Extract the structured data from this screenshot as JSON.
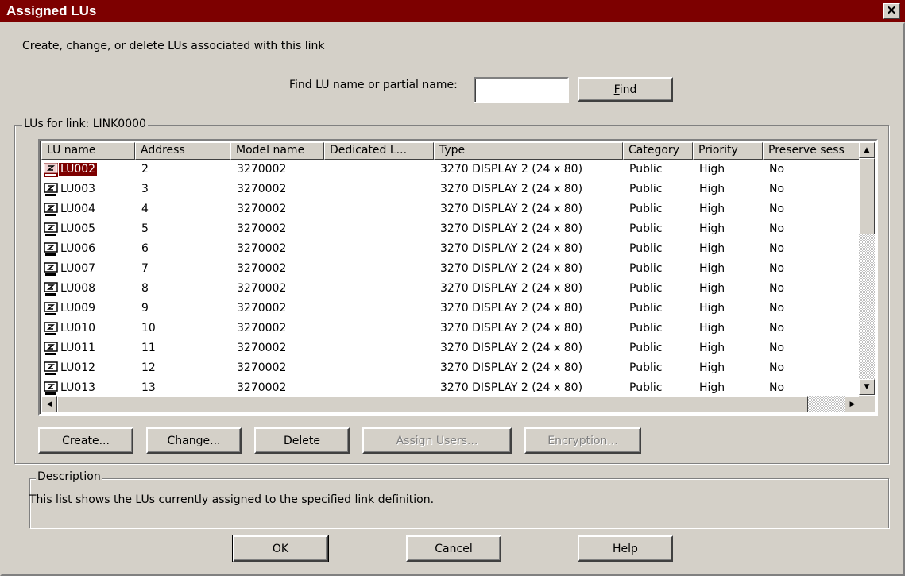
{
  "window": {
    "title": "Assigned LUs",
    "close_label": "✕"
  },
  "intro_text": "Create, change, or delete LUs associated with this link",
  "find": {
    "label": "Find LU name or partial name:",
    "value": "",
    "button_label": "Find",
    "button_accel": "F"
  },
  "lus_group": {
    "label": "LUs for link:  LINK0000"
  },
  "table": {
    "columns": [
      "LU name",
      "Address",
      "Model name",
      "Dedicated L...",
      "Type",
      "Category",
      "Priority",
      "Preserve sess"
    ],
    "rows": [
      {
        "lu": "LU002",
        "address": "2",
        "model": "3270002",
        "dedicated": "",
        "type": "3270 DISPLAY 2 (24 x 80)",
        "category": "Public",
        "priority": "High",
        "preserve": "No"
      },
      {
        "lu": "LU003",
        "address": "3",
        "model": "3270002",
        "dedicated": "",
        "type": "3270 DISPLAY 2 (24 x 80)",
        "category": "Public",
        "priority": "High",
        "preserve": "No"
      },
      {
        "lu": "LU004",
        "address": "4",
        "model": "3270002",
        "dedicated": "",
        "type": "3270 DISPLAY 2 (24 x 80)",
        "category": "Public",
        "priority": "High",
        "preserve": "No"
      },
      {
        "lu": "LU005",
        "address": "5",
        "model": "3270002",
        "dedicated": "",
        "type": "3270 DISPLAY 2 (24 x 80)",
        "category": "Public",
        "priority": "High",
        "preserve": "No"
      },
      {
        "lu": "LU006",
        "address": "6",
        "model": "3270002",
        "dedicated": "",
        "type": "3270 DISPLAY 2 (24 x 80)",
        "category": "Public",
        "priority": "High",
        "preserve": "No"
      },
      {
        "lu": "LU007",
        "address": "7",
        "model": "3270002",
        "dedicated": "",
        "type": "3270 DISPLAY 2 (24 x 80)",
        "category": "Public",
        "priority": "High",
        "preserve": "No"
      },
      {
        "lu": "LU008",
        "address": "8",
        "model": "3270002",
        "dedicated": "",
        "type": "3270 DISPLAY 2 (24 x 80)",
        "category": "Public",
        "priority": "High",
        "preserve": "No"
      },
      {
        "lu": "LU009",
        "address": "9",
        "model": "3270002",
        "dedicated": "",
        "type": "3270 DISPLAY 2 (24 x 80)",
        "category": "Public",
        "priority": "High",
        "preserve": "No"
      },
      {
        "lu": "LU010",
        "address": "10",
        "model": "3270002",
        "dedicated": "",
        "type": "3270 DISPLAY 2 (24 x 80)",
        "category": "Public",
        "priority": "High",
        "preserve": "No"
      },
      {
        "lu": "LU011",
        "address": "11",
        "model": "3270002",
        "dedicated": "",
        "type": "3270 DISPLAY 2 (24 x 80)",
        "category": "Public",
        "priority": "High",
        "preserve": "No"
      },
      {
        "lu": "LU012",
        "address": "12",
        "model": "3270002",
        "dedicated": "",
        "type": "3270 DISPLAY 2 (24 x 80)",
        "category": "Public",
        "priority": "High",
        "preserve": "No"
      },
      {
        "lu": "LU013",
        "address": "13",
        "model": "3270002",
        "dedicated": "",
        "type": "3270 DISPLAY 2 (24 x 80)",
        "category": "Public",
        "priority": "High",
        "preserve": "No"
      }
    ],
    "selected_row": 0,
    "row_icon": "display-terminal-icon"
  },
  "actions": {
    "create": "Create...",
    "change": "Change...",
    "delete": "Delete",
    "assign_users": "Assign Users...",
    "encryption": "Encryption..."
  },
  "description": {
    "label": "Description",
    "text": "This list shows the LUs currently assigned to the specified link definition."
  },
  "footer": {
    "ok": "OK",
    "cancel": "Cancel",
    "help": "Help"
  },
  "colors": {
    "title_bg": "#7d0000",
    "selection_bg": "#7d0000",
    "face": "#d4d0c8"
  }
}
